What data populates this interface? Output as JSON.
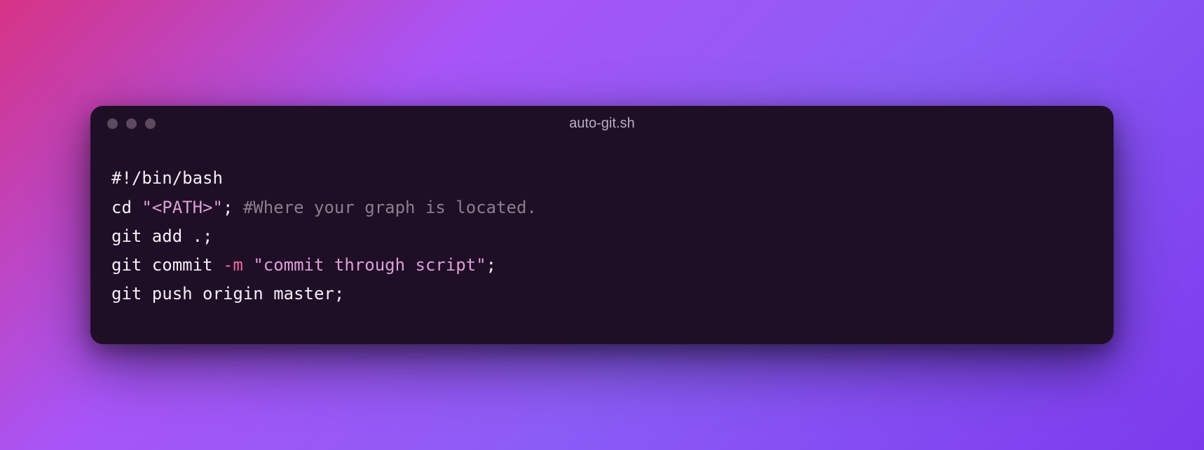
{
  "window": {
    "title": "auto-git.sh"
  },
  "code": {
    "line1": "#!/bin/bash",
    "line2_a": "cd ",
    "line2_b": "\"<PATH>\"",
    "line2_c": "; ",
    "line2_d": "#Where your graph is located.",
    "line3": "git add .;",
    "line4_a": "git commit ",
    "line4_b": "-m",
    "line4_c": " ",
    "line4_d": "\"commit through script\"",
    "line4_e": ";",
    "line5": "git push origin master;"
  },
  "colors": {
    "background_gradient_start": "#d63384",
    "background_gradient_end": "#7c3aed",
    "window_background": "#1e0f26",
    "text_default": "#f5eff7",
    "text_string": "#dd9fd6",
    "text_comment": "#8a7f8c",
    "text_flag": "#f06a9b"
  }
}
